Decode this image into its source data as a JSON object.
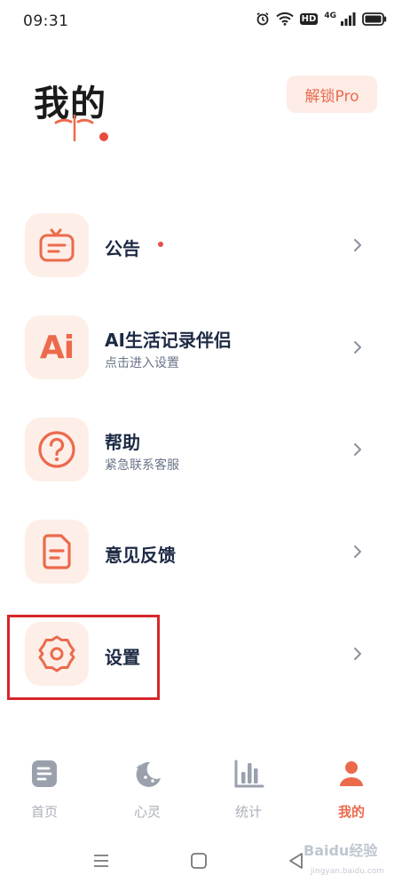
{
  "status_bar": {
    "time": "09:31",
    "icons": [
      "alarm-icon",
      "wifi-icon",
      "hd-badge",
      "cellular-signal-icon",
      "battery-icon"
    ],
    "hd_label": "HD",
    "network_label": "4G"
  },
  "header": {
    "title": "我的",
    "unlock_button": "解锁Pro"
  },
  "menu": {
    "items": [
      {
        "label": "公告",
        "icon": "announcement-icon",
        "has_dot": true
      },
      {
        "label": "AI生活记录伴侣",
        "sub": "点击进入设置",
        "icon": "ai-icon",
        "icon_text": "Ai"
      },
      {
        "label": "帮助",
        "sub": "紧急联系客服",
        "icon": "help-icon"
      },
      {
        "label": "意见反馈",
        "icon": "feedback-icon"
      },
      {
        "label": "设置",
        "icon": "settings-gear-icon",
        "highlighted": true
      }
    ]
  },
  "bottom_nav": {
    "tabs": [
      {
        "label": "首页",
        "icon": "home-document-icon",
        "active": false
      },
      {
        "label": "心灵",
        "icon": "moon-stars-icon",
        "active": false
      },
      {
        "label": "统计",
        "icon": "bar-chart-icon",
        "active": false
      },
      {
        "label": "我的",
        "icon": "person-icon",
        "active": true
      }
    ]
  },
  "system_nav": {
    "icons": [
      "menu-lines-icon",
      "home-square-icon",
      "back-triangle-icon"
    ]
  },
  "watermark": {
    "text": "Baidu经验",
    "sub": "jingyan.baidu.com"
  },
  "colors": {
    "accent": "#ec6a4c",
    "icon_bg": "#fdeee8",
    "text_primary": "#1d2a44",
    "text_secondary": "#6a7488",
    "nav_inactive": "#aab0ba",
    "highlight_border": "#d7262a"
  }
}
